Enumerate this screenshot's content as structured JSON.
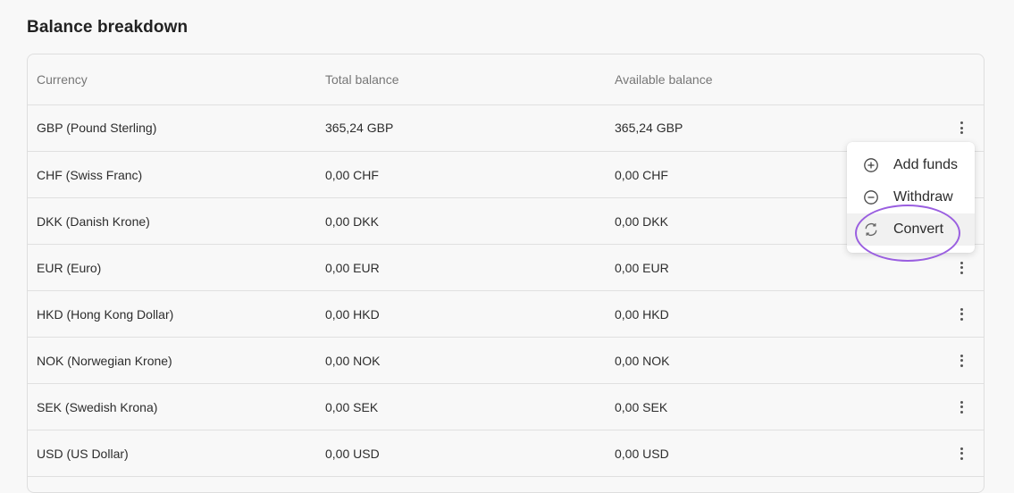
{
  "page": {
    "title": "Balance breakdown"
  },
  "table": {
    "headers": [
      "Currency",
      "Total balance",
      "Available balance"
    ],
    "rows": [
      {
        "currency": "GBP (Pound Sterling)",
        "total": "365,24 GBP",
        "available": "365,24 GBP"
      },
      {
        "currency": "CHF (Swiss Franc)",
        "total": "0,00 CHF",
        "available": "0,00 CHF"
      },
      {
        "currency": "DKK (Danish Krone)",
        "total": "0,00 DKK",
        "available": "0,00 DKK"
      },
      {
        "currency": "EUR (Euro)",
        "total": "0,00 EUR",
        "available": "0,00 EUR"
      },
      {
        "currency": "HKD (Hong Kong Dollar)",
        "total": "0,00 HKD",
        "available": "0,00 HKD"
      },
      {
        "currency": "NOK (Norwegian Krone)",
        "total": "0,00 NOK",
        "available": "0,00 NOK"
      },
      {
        "currency": "SEK (Swedish Krona)",
        "total": "0,00 SEK",
        "available": "0,00 SEK"
      },
      {
        "currency": "USD (US Dollar)",
        "total": "0,00 USD",
        "available": "0,00 USD"
      }
    ]
  },
  "menu": {
    "items": [
      {
        "label": "Add funds",
        "icon": "plus-circle-icon"
      },
      {
        "label": "Withdraw",
        "icon": "minus-circle-icon"
      },
      {
        "label": "Convert",
        "icon": "convert-arrows-icon"
      }
    ],
    "highlighted_item": "Convert"
  },
  "colors": {
    "annotation": "#9a5fe0",
    "border": "#dedede",
    "muted_text": "#767676"
  }
}
